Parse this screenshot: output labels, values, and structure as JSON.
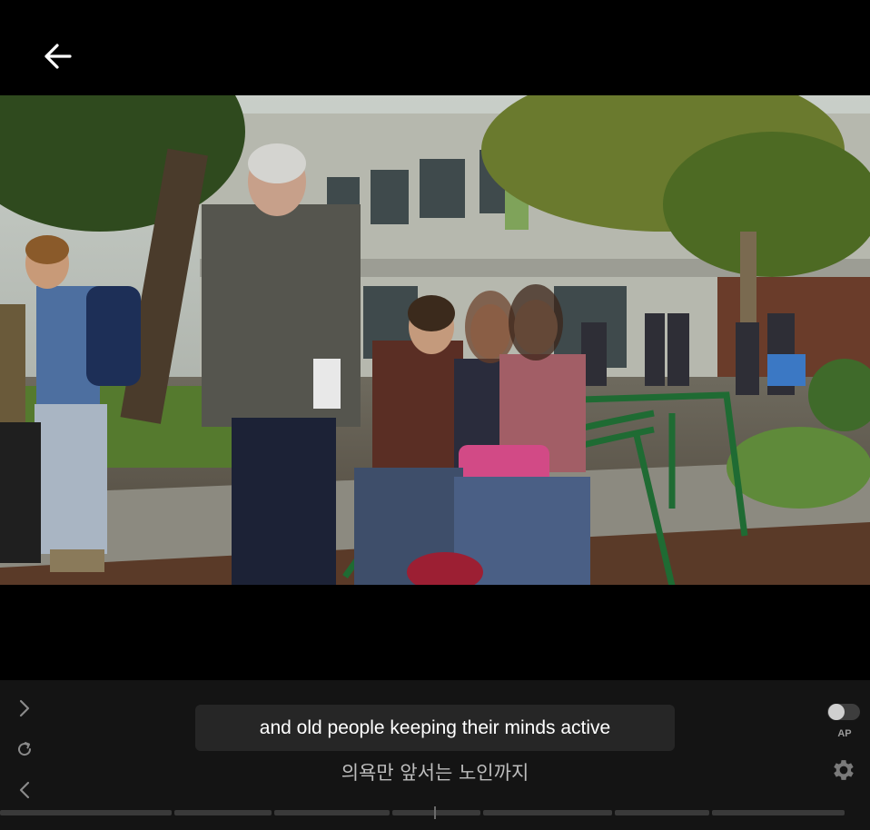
{
  "player": {
    "subtitle_primary": "and old people keeping their minds active",
    "subtitle_translation": "의욕만 앞서는 노인까지",
    "autoplay_label": "AP",
    "autoplay_enabled": false
  },
  "icons": {
    "back": "arrow-left-icon",
    "next": "chevron-right-icon",
    "replay": "refresh-icon",
    "previous": "chevron-left-icon",
    "settings": "gear-icon"
  },
  "timeline_segments": 7
}
